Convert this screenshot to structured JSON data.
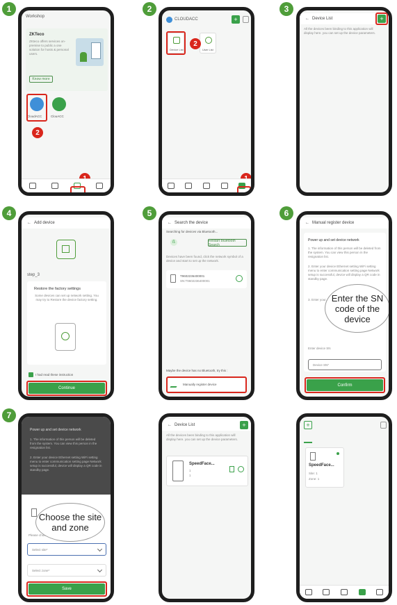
{
  "steps": [
    "1",
    "2",
    "3",
    "4",
    "5",
    "6",
    "7"
  ],
  "markers": {
    "one": "1",
    "two": "2"
  },
  "s1": {
    "title": "Workshop",
    "brand": "ZKTeco",
    "desc": "ZKteco offers services on-premise to public a one solution for hosts & personal users.",
    "know_more": "Know more",
    "app1": "CloudACC",
    "app2": "ClouACC"
  },
  "s2": {
    "title": "CLOUDACC",
    "item1": "Device List",
    "item2": "User List"
  },
  "s3": {
    "title": "Device List",
    "desc": "All the devices been binding to this application will display here. you can set up the device parameters."
  },
  "s4": {
    "title": "Add device",
    "step": "step_3",
    "heading": "Restore the factory settings",
    "desc": "Some devices can set up network setting. You may try to Restore the device factory setting.",
    "check": "I had read these instruction",
    "button": "Continue"
  },
  "s5": {
    "title": "Search the device",
    "searching": "Searching for devices via Bluetooth...",
    "bt_button": "Restart Bluetooth Search",
    "info": "Devices have been found, click the network symbol of a device and start to set up the network.",
    "device_sn": "T9602236400001",
    "device_sub": "SN:T9602236400001",
    "hint": "Maybe the device has no Bluetooth, try this :",
    "manual": "Manually register device"
  },
  "s6": {
    "title": "Manual register device",
    "heading": "Power up and set device network",
    "p1": "1. The information of this person will be deleted from the system. You can view this person in the resignation list.",
    "p2": "2. Enter your device Ethernet setting WiFi setting menu to enter communication setting page Network setup is successful, device will display a QR code in standby page.",
    "p3": "3. Enter your...",
    "enter_label": "Enter device SN",
    "input_ph": "Device SN*",
    "button": "Confirm",
    "bubble": "Enter the SN code of the device"
  },
  "s7": {
    "heading": "Power up and set device network",
    "p1": "1. The information of this person will be deleted from the system. You can view this person in the resignation list.",
    "p2": "2. Enter your device Ethernet setting WiFi setting menu to enter communication setting page Network setup is successful, device will display a QR code in standby page.",
    "choose": "Please choose...",
    "site_ph": "Select site*",
    "zone_ph": "Select zone*",
    "button": "Save",
    "bubble": "Choose the site and zone"
  },
  "s8": {
    "title": "Device List",
    "desc": "All the devices been binding to this application will display here. you can set up the device parameters.",
    "device": "SpeedFace...",
    "l1": "1",
    "l2": "1"
  },
  "s9": {
    "device": "SpeedFace...",
    "site": "Site: 1",
    "zone": "Zone: 1"
  },
  "colors": {
    "accent": "#3aa14a",
    "step": "#4f9d3a",
    "marker": "#d9261c"
  }
}
